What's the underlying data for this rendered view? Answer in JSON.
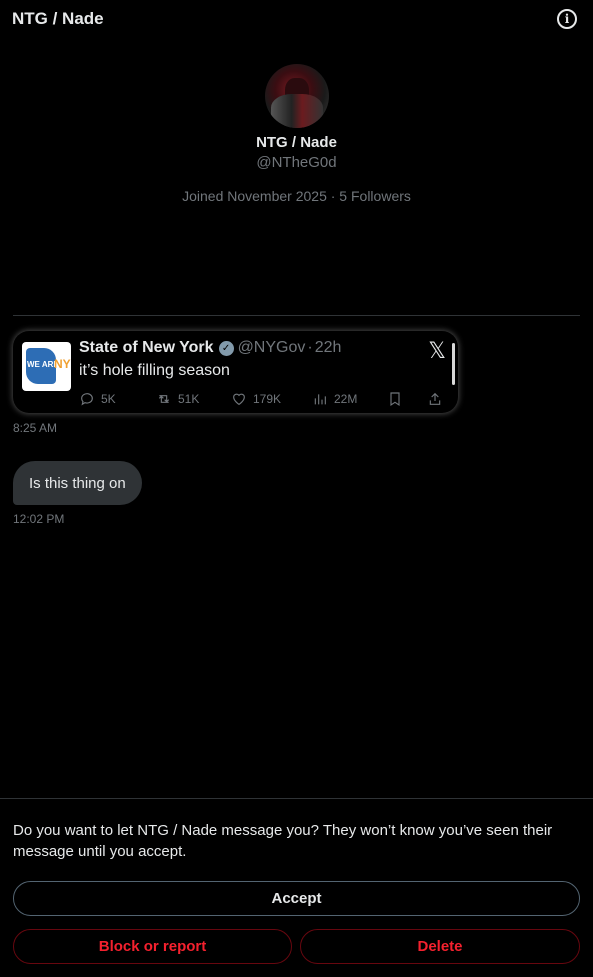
{
  "header": {
    "title": "NTG / Nade",
    "info_icon": "info-circle-icon"
  },
  "profile": {
    "name": "NTG / Nade",
    "handle": "@NTheG0d",
    "meta": "Joined November 2025 · 5 Followers"
  },
  "shared_tweet": {
    "logo_text": "WE ARE",
    "logo_ny": "NY",
    "author": "State of New York",
    "handle": "@NYGov",
    "separator": "·",
    "time": "22h",
    "text": "it’s hole filling season",
    "replies": "5K",
    "retweets": "51K",
    "likes": "179K",
    "views": "22M",
    "brand_icon": "x-logo-icon"
  },
  "messages": [
    {
      "timestamp": "8:25 AM"
    },
    {
      "text": "Is this thing on",
      "timestamp": "12:02 PM"
    }
  ],
  "request": {
    "prompt": "Do you want to let NTG / Nade message you? They won’t know you’ve seen their message until you accept.",
    "accept_label": "Accept",
    "block_label": "Block or report",
    "delete_label": "Delete",
    "danger_color": "#f4212e"
  }
}
